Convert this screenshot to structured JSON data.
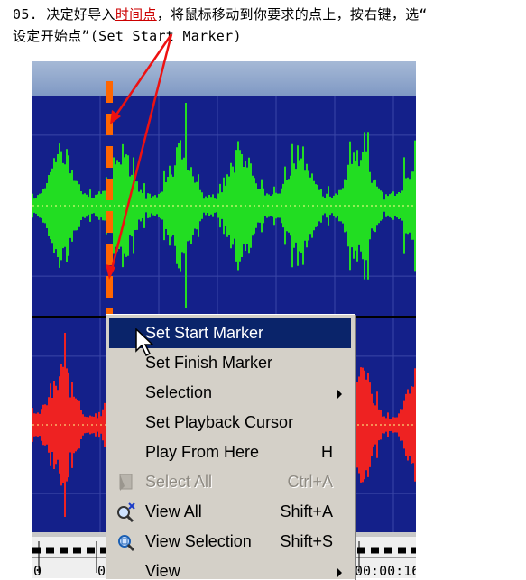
{
  "caption": {
    "line1_prefix": "05. 决定好导入",
    "line1_highlight": "时间点",
    "line1_suffix": "，将鼠标移动到你要求的点上，按右键，选“",
    "line2": "设定开始点”(Set Start Marker)"
  },
  "context_menu": {
    "items": [
      {
        "label": "Set Start Marker",
        "shortcut": "",
        "state": "selected",
        "icon": "",
        "submenu": false
      },
      {
        "label": "Set Finish Marker",
        "shortcut": "",
        "state": "normal",
        "icon": "",
        "submenu": false
      },
      {
        "label": "Selection",
        "shortcut": "",
        "state": "normal",
        "icon": "",
        "submenu": true
      },
      {
        "label": "Set Playback Cursor",
        "shortcut": "",
        "state": "normal",
        "icon": "",
        "submenu": false
      },
      {
        "label": "Play From Here",
        "shortcut": "H",
        "state": "normal",
        "icon": "",
        "submenu": false
      },
      {
        "label": "Select All",
        "shortcut": "Ctrl+A",
        "state": "disabled",
        "icon": "select-all-icon",
        "submenu": false
      },
      {
        "label": "View All",
        "shortcut": "Shift+A",
        "state": "normal",
        "icon": "zoom-out-icon",
        "submenu": false
      },
      {
        "label": "View Selection",
        "shortcut": "Shift+S",
        "state": "normal",
        "icon": "zoom-selection-icon",
        "submenu": false
      },
      {
        "label": "View",
        "shortcut": "",
        "state": "normal",
        "icon": "",
        "submenu": true
      }
    ]
  },
  "ruler": {
    "labels": [
      "0",
      "0",
      "00:00:16"
    ]
  },
  "colors": {
    "track_background": "#14208a",
    "waveform_top": "#22dd22",
    "waveform_bottom": "#ee2222",
    "marker_dashes": "#ff6600",
    "annotation_arrows": "#ee1111",
    "menu_highlight": "#0a246a"
  }
}
